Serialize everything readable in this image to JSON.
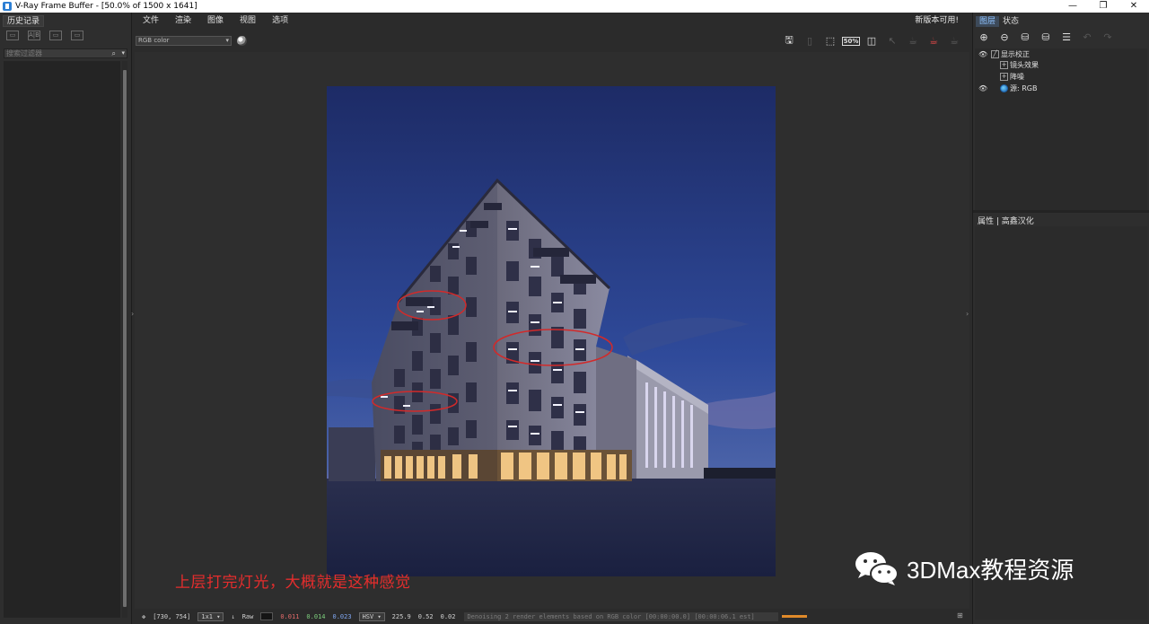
{
  "window": {
    "title": "V-Ray Frame Buffer - [50.0% of 1500 x 1641]",
    "controls": [
      "—",
      "❐",
      "✕"
    ]
  },
  "left_panel": {
    "tab": "历史记录",
    "filter_placeholder": "搜索过滤器"
  },
  "menu": {
    "items": [
      "文件",
      "渲染",
      "图像",
      "视图",
      "选项"
    ],
    "notice": "新版本可用!"
  },
  "toolbar": {
    "channel": "RGB color",
    "zoom_badge": "50%"
  },
  "right_panel": {
    "tabs": [
      "图层",
      "状态"
    ],
    "layers": [
      {
        "label": "显示校正",
        "visible": true,
        "indent": 0
      },
      {
        "label": "镜头效果",
        "visible": false,
        "indent": 1
      },
      {
        "label": "降噪",
        "visible": false,
        "indent": 1
      },
      {
        "label": "源: RGB",
        "visible": true,
        "indent": 0
      }
    ],
    "properties_title": "属性 | 高鑫汉化"
  },
  "status": {
    "coords": "[730, 754]",
    "ratio": "1x1",
    "mode": "Raw",
    "r": "0.011",
    "g": "0.014",
    "b": "0.023",
    "color_space": "HSV",
    "h": "225.9",
    "s": "0.52",
    "v": "0.02",
    "message": "Denoising 2 render elements based on RGB color [00:00:00.0] [00:00:06.1 est]"
  },
  "overlay": {
    "caption": "上层打完灯光，大概就是这种感觉",
    "watermark": "3DMax教程资源"
  },
  "colors": {
    "caption": "#e52d2d",
    "annotation_ellipse": "#d22a2a",
    "sky_top": "#1e2f6a",
    "sky_horizon": "#f2a06b"
  }
}
